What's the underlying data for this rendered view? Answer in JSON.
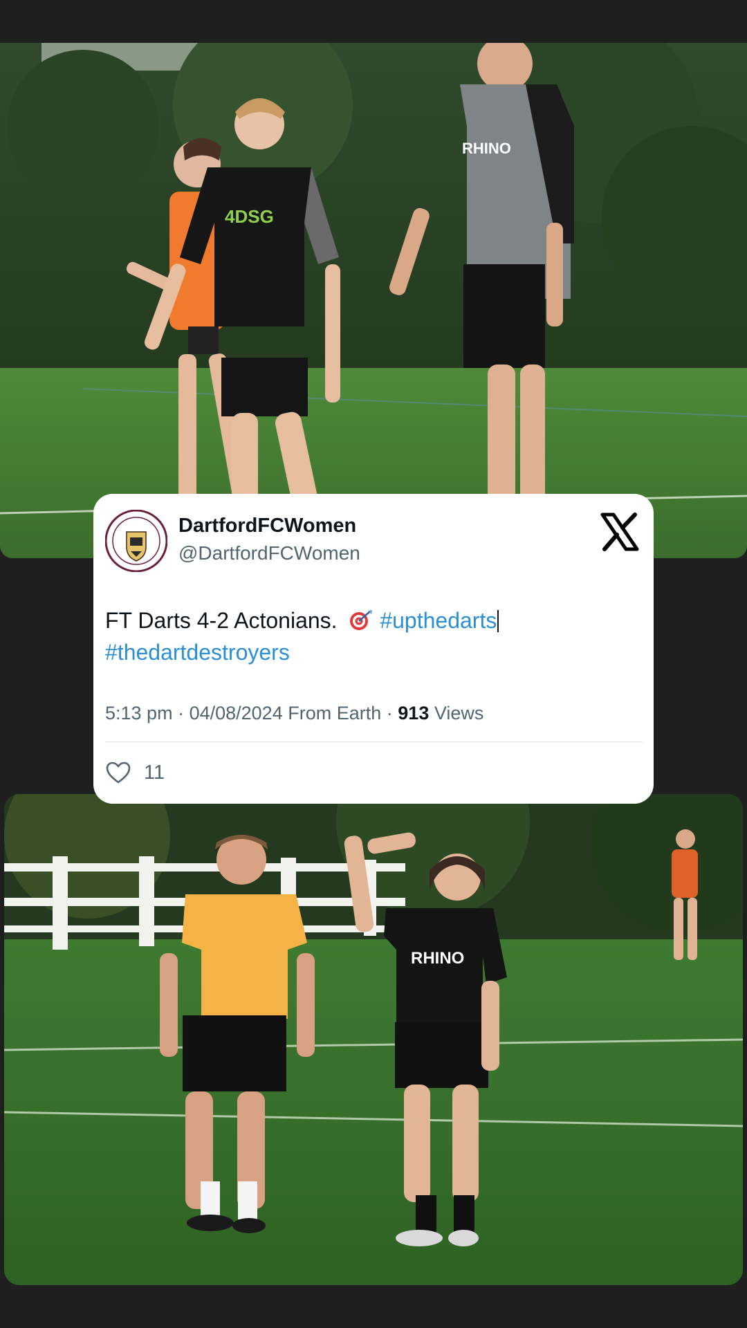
{
  "tweet": {
    "display_name": "DartfordFCWomen",
    "handle": "@DartfordFCWomen",
    "text_plain": "FT Darts 4-2 Actonians.",
    "hashtag_1": "#upthedarts",
    "hashtag_2": "#thedartdestroyers",
    "time": "5:13 pm",
    "date": "04/08/2024",
    "source": "From Earth",
    "views_count": "913",
    "views_label": "Views",
    "likes": "11"
  },
  "icons": {
    "logo": "x-logo-icon",
    "like": "heart-icon",
    "emoji": "dart-target-emoji"
  },
  "colors": {
    "hashtag": "#2b8fd6",
    "background": "#1f1f1f",
    "card": "#ffffff",
    "secondary_text": "#536471"
  }
}
